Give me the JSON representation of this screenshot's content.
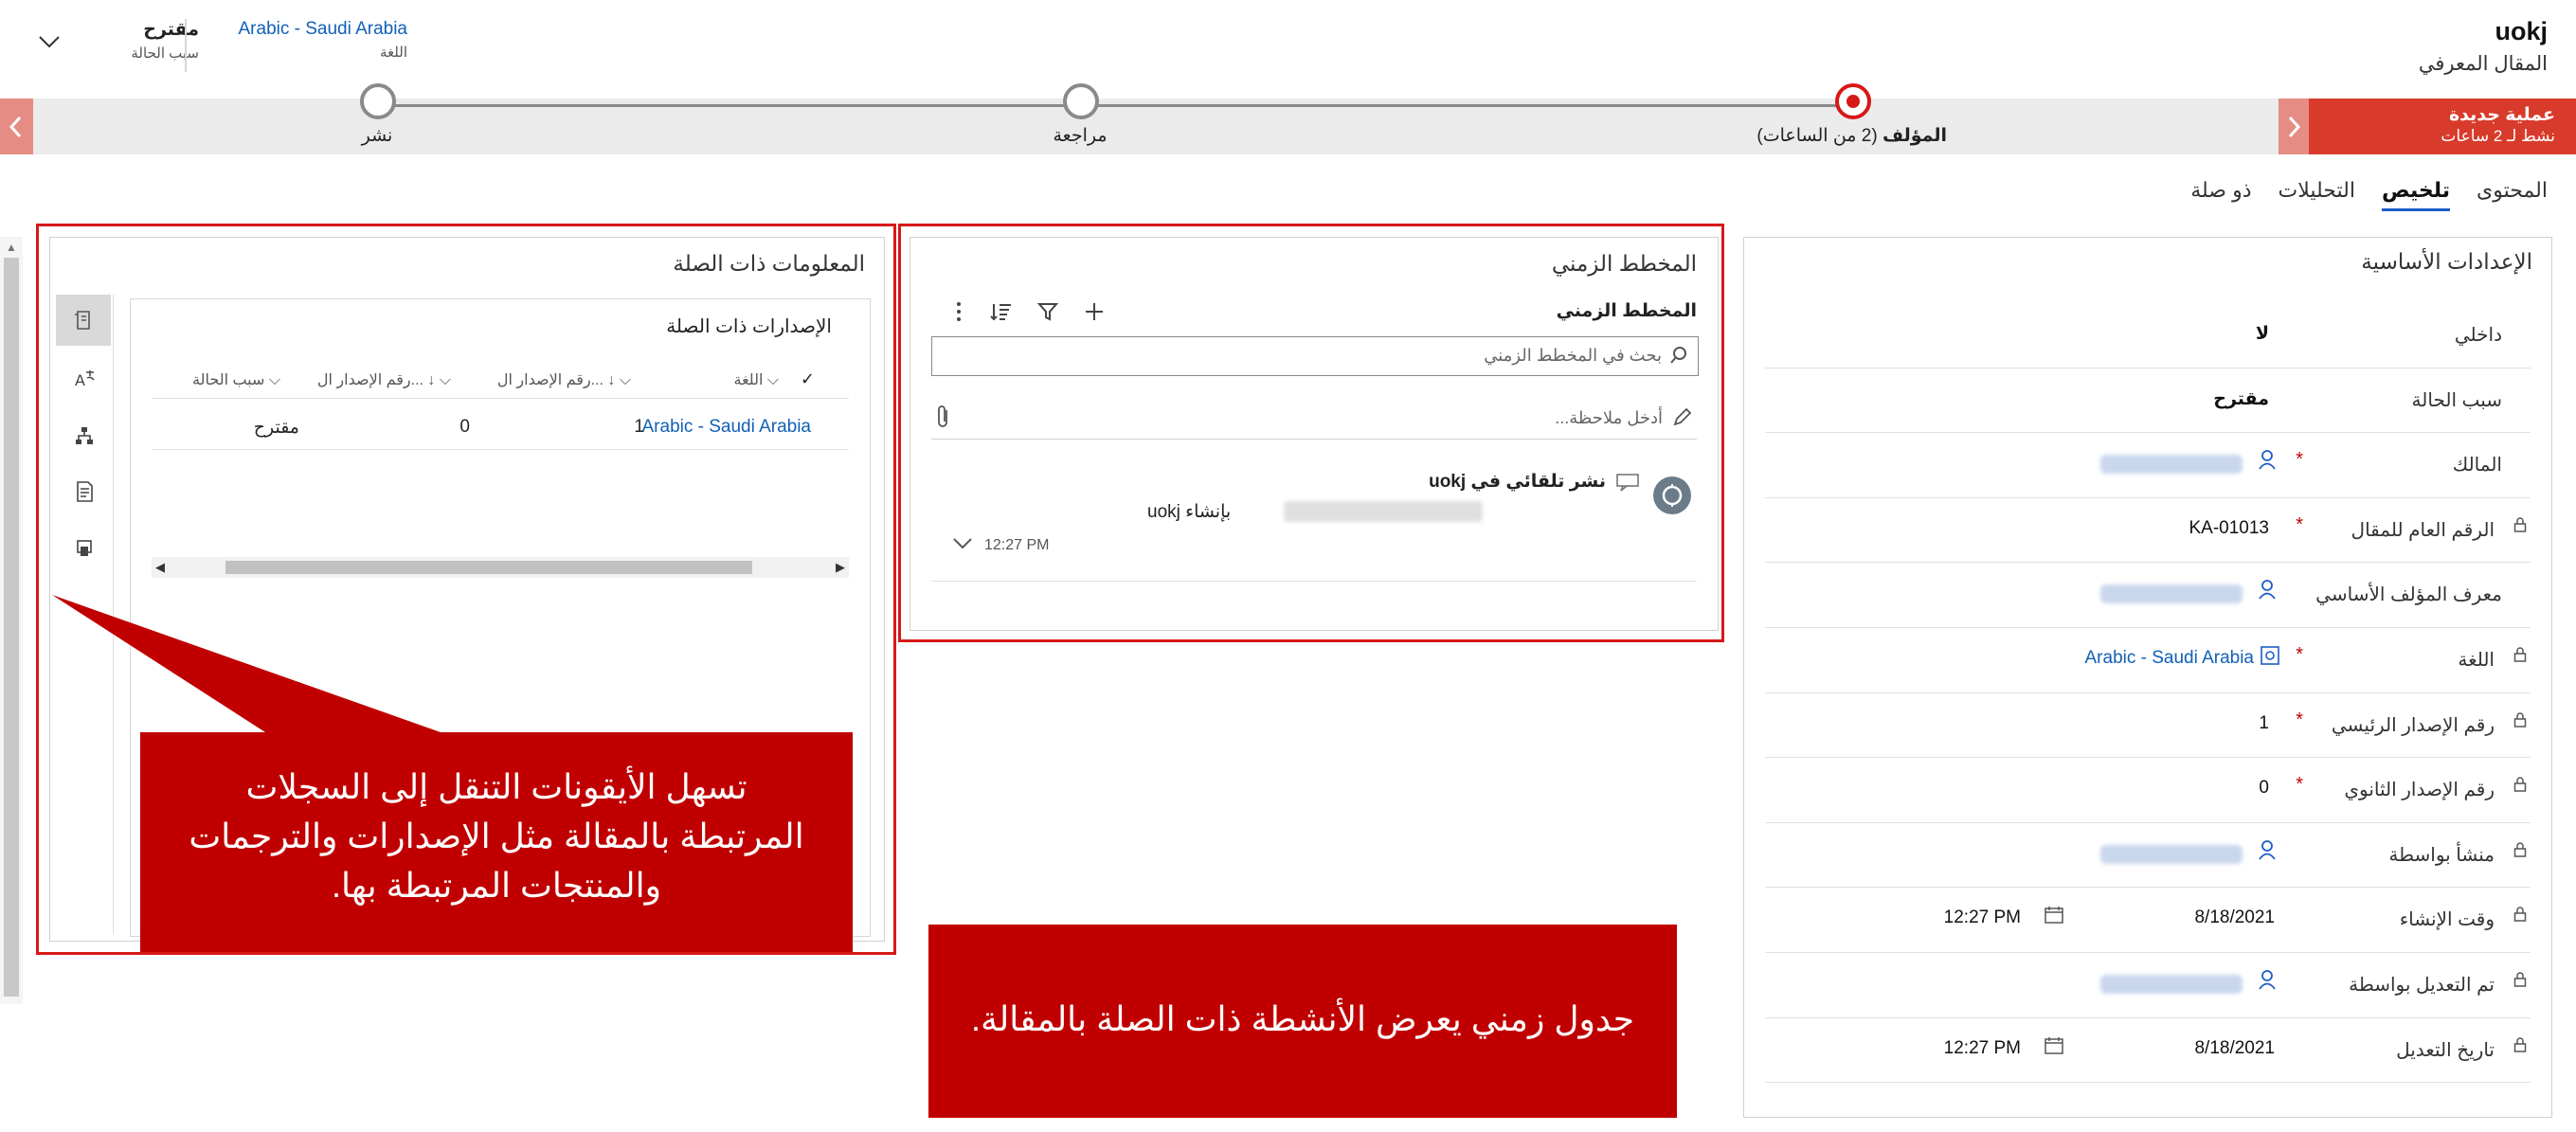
{
  "header": {
    "record_title": "uokj",
    "entity_name": "المقال المعرفي",
    "language_value": "Arabic - Saudi Arabia",
    "language_label": "اللغة",
    "status_reason_value": "مقترح",
    "status_reason_label": "سبب الحالة"
  },
  "bpf": {
    "active_process_title": "عملية جديدة",
    "active_process_sub": "نشط لـ 2 ساعات",
    "stages": [
      {
        "label": "المؤلف",
        "extra": "(2 من الساعات)"
      },
      {
        "label": "مراجعة"
      },
      {
        "label": "نشر"
      }
    ]
  },
  "tabs": [
    "المحتوى",
    "تلخيص",
    "التحليلات",
    "ذو صلة"
  ],
  "general": {
    "title": "الإعدادات الأساسية",
    "fields": [
      {
        "label": "داخلي",
        "value": "لا"
      },
      {
        "label": "سبب الحالة",
        "value": "مقترح"
      },
      {
        "label": "المالك",
        "value": ""
      },
      {
        "label": "الرقم العام للمقال",
        "value": "KA-01013"
      },
      {
        "label": "معرف المؤلف الأساسي",
        "value": ""
      },
      {
        "label": "اللغة",
        "value": "Arabic - Saudi Arabia"
      },
      {
        "label": "رقم الإصدار الرئيسي",
        "value": "1"
      },
      {
        "label": "رقم الإصدار الثانوي",
        "value": "0"
      },
      {
        "label": "منشأ بواسطة",
        "value": ""
      },
      {
        "label": "وقت الإنشاء",
        "date": "8/18/2021",
        "time": "12:27 PM"
      },
      {
        "label": "تم التعديل بواسطة",
        "value": ""
      },
      {
        "label": "تاريخ التعديل",
        "date": "8/18/2021",
        "time": "12:27 PM"
      }
    ]
  },
  "timeline": {
    "section_title": "المخطط الزمني",
    "header": "المخطط الزمني",
    "search_placeholder": "بحث في المخطط الزمني",
    "note_placeholder": "أدخل ملاحظة...",
    "entry": {
      "title": "نشر تلقائي في uokj",
      "body": "بإنشاء uokj",
      "time": "12:27 PM"
    }
  },
  "related": {
    "section_title": "المعلومات ذات الصلة",
    "grid_title": "الإصدارات ذات الصلة",
    "columns": [
      "اللغة",
      "رقم الإصدار ال...",
      "رقم الإصدار ال...",
      "سبب الحالة"
    ],
    "row": {
      "language": "Arabic - Saudi Arabia",
      "major": "1",
      "minor": "0",
      "status": "مقترح"
    }
  },
  "callouts": {
    "related_note": "تسهل الأيقونات التنقل إلى السجلات المرتبطة بالمقالة مثل الإصدارات والترجمات والمنتجات المرتبطة بها.",
    "timeline_note": "جدول زمني يعرض الأنشطة ذات الصلة بالمقالة."
  },
  "colors": {
    "accent_red": "#d71818",
    "callout_red": "#c00000",
    "link_blue": "#1160b7",
    "process_red": "#d83b2b"
  }
}
